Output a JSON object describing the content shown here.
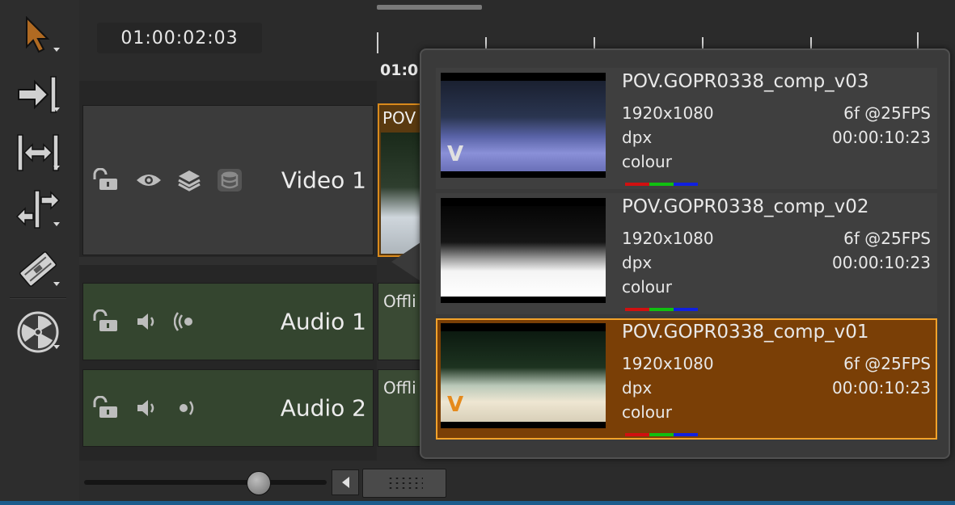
{
  "timecode": "01:00:02:03",
  "ruler": {
    "label": "01:0"
  },
  "toolbar": {
    "tools": [
      {
        "name": "select-tool",
        "icon": "cursor-arrow-icon"
      },
      {
        "name": "track-forward-tool",
        "icon": "arrow-to-bar-icon"
      },
      {
        "name": "multi-tool",
        "icon": "range-icon"
      },
      {
        "name": "slip-tool",
        "icon": "slip-arrows-icon"
      },
      {
        "name": "razor-tool",
        "icon": "razor-icon"
      },
      {
        "name": "viewer-tool",
        "icon": "hazard-disc-icon"
      }
    ]
  },
  "tracks": {
    "video": {
      "name": "Video 1",
      "clip_label": "POV"
    },
    "audio1": {
      "name": "Audio 1",
      "clip_label": "Offli"
    },
    "audio2": {
      "name": "Audio 2",
      "clip_label": "Offli"
    }
  },
  "versions": [
    {
      "name": "POV.GOPR0338_comp_v03",
      "resolution": "1920x1080",
      "fps": "6f @25FPS",
      "format": "dpx",
      "duration": "00:00:10:23",
      "colorspace": "colour",
      "badge": "V",
      "selected": false
    },
    {
      "name": "POV.GOPR0338_comp_v02",
      "resolution": "1920x1080",
      "fps": "6f @25FPS",
      "format": "dpx",
      "duration": "00:00:10:23",
      "colorspace": "colour",
      "badge": "",
      "selected": false
    },
    {
      "name": "POV.GOPR0338_comp_v01",
      "resolution": "1920x1080",
      "fps": "6f @25FPS",
      "format": "dpx",
      "duration": "00:00:10:23",
      "colorspace": "colour",
      "badge": "V",
      "selected": true
    }
  ],
  "colors": {
    "selected_fill": "#7a3f06",
    "selected_border": "#f2a22a",
    "audio_track": "#34452f",
    "video_track": "#3b3b3b"
  }
}
